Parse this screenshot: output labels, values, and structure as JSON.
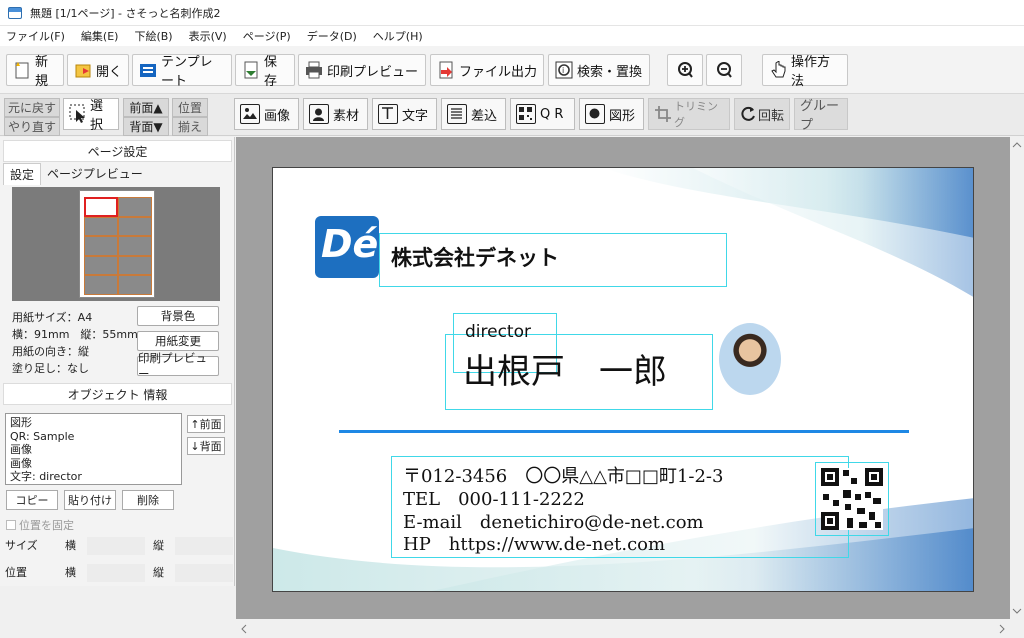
{
  "window": {
    "title": "無題 [1/1ページ] - さそっと名刺作成2"
  },
  "menu": [
    "ファイル(F)",
    "編集(E)",
    "下絵(B)",
    "表示(V)",
    "ページ(P)",
    "データ(D)",
    "ヘルプ(H)"
  ],
  "toolbar": {
    "new": "新規",
    "open": "開く",
    "template": "テンプレート",
    "save": "保存",
    "print_preview": "印刷プレビュー",
    "file_export": "ファイル出力",
    "search_replace": "検索・置換",
    "howto": "操作方法"
  },
  "toolbar2": {
    "undo": "元に戻す",
    "redo": "やり直す",
    "select": "選択",
    "front": "前面▲",
    "back": "背面▼",
    "pos": "位置",
    "align": "揃え",
    "image": "画像",
    "material": "素材",
    "text": "文字",
    "insert": "差込",
    "qr": "Q R",
    "shape": "図形",
    "trim": "トリミング",
    "rotate": "回転",
    "group": "グループ"
  },
  "left": {
    "page_settings_header": "ページ設定",
    "tab_settings": "設定",
    "tab_preview": "ページプレビュー",
    "paper_size": "用紙サイズ：A4",
    "dimensions": "横：91mm　縦：55mm",
    "orientation": "用紙の向き：縦",
    "bleed": "塗り足し：なし",
    "btn_bgcolor": "背景色",
    "btn_paper_change": "用紙変更",
    "btn_print_preview": "印刷プレビュー",
    "object_info_header": "オブジェクト 情報",
    "objects": [
      "図形",
      "QR: Sample",
      "画像",
      "画像",
      "文字: director"
    ],
    "btn_front": "↑前面",
    "btn_back": "↓背面",
    "btn_copy": "コピー",
    "btn_paste": "貼り付け",
    "btn_delete": "削除",
    "fix_position": "位置を固定",
    "size_label": "サイズ",
    "position_label": "位置",
    "horizontal": "横",
    "vertical": "縦"
  },
  "card": {
    "logo_text": "Dé",
    "company": "株式会社デネット",
    "role": "director",
    "name": "出根戸　一郎",
    "address": "〒012-3456　〇〇県△△市□□町1-2-3",
    "tel": "TEL　000-111-2222",
    "email": "E-mail　denetichiro@de-net.com",
    "hp": "HP　https://www.de-net.com"
  },
  "colors": {
    "accent": "#1e88e5",
    "logo": "#1d6fc0",
    "selection": "#40d8e8"
  }
}
